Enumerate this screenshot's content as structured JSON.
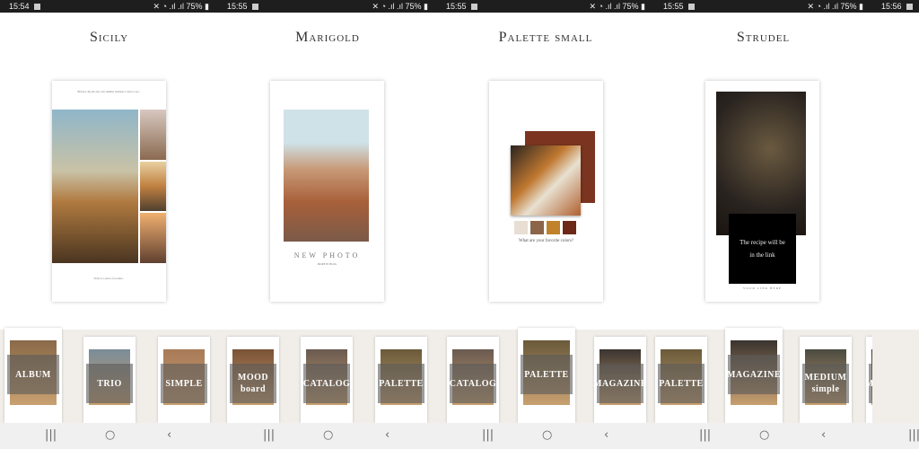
{
  "panels": [
    {
      "time": "15:54",
      "battery": "75%",
      "title": "Sicily",
      "card": {
        "caption_top": "Before I dig into my own summer business I want to say...",
        "caption_bottom": "Sicily is a place of wonder..."
      },
      "thumbs": [
        {
          "label": "ALBUM",
          "selected": true,
          "tone": "#8a6a48"
        },
        {
          "label": "TRIO",
          "tone": "#7a8c98"
        },
        {
          "label": "SIMPLE",
          "tone": "#a87a58"
        }
      ]
    },
    {
      "time": "15:55",
      "battery": "75%",
      "title": "Marigold",
      "card": {
        "heading": "NEW PHOTO",
        "sub": "MORE IN BLOG"
      },
      "thumbs": [
        {
          "label": "MOOD board",
          "tone": "#7a5236"
        },
        {
          "label": "CATALOG",
          "tone": "#6a5a50"
        },
        {
          "label": "PALETTE",
          "tone": "#6a5a3a"
        }
      ]
    },
    {
      "time": "15:55",
      "battery": "75%",
      "title": "Palette small",
      "card": {
        "question": "What are your favorite colors?",
        "swatches": [
          "#e8ded4",
          "#8c6448",
          "#c0822a",
          "#6e2818"
        ]
      },
      "thumbs": [
        {
          "label": "CATALOG",
          "tone": "#6a5a50"
        },
        {
          "label": "PALETTE",
          "selected": true,
          "tone": "#6a5a3a"
        },
        {
          "label": "MAGAZINE",
          "tone": "#3a3430"
        }
      ]
    },
    {
      "time": "15:55",
      "battery": "75%",
      "title": "Strudel",
      "card": {
        "box_text": "The recipe will be in the link",
        "link": "YOUR LINK HERE"
      },
      "thumbs": [
        {
          "label": "PALETTE",
          "tone": "#6a5a3a"
        },
        {
          "label": "MAGAZINE",
          "selected": true,
          "tone": "#3a3430"
        },
        {
          "label": "MEDIUM simple",
          "tone": "#4a4a40"
        },
        {
          "label": "MAGAZINE",
          "tone": "#3a3430"
        }
      ]
    },
    {
      "time": "15:56",
      "battery": "",
      "title": "",
      "thumbs": []
    }
  ],
  "nav": {
    "recents": "|||",
    "home": "○",
    "back": "‹"
  }
}
